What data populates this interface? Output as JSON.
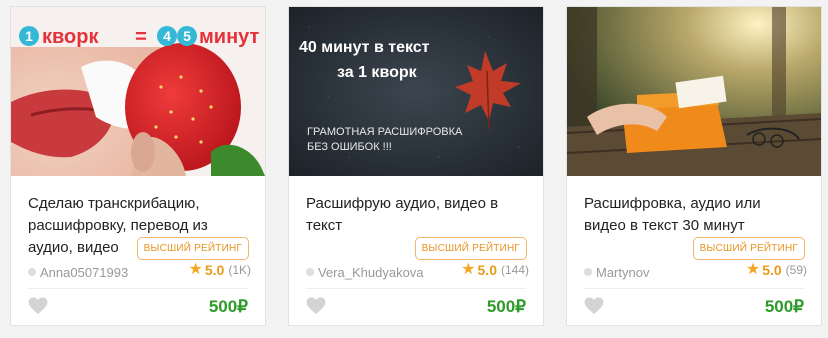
{
  "cards": [
    {
      "image": {
        "counter_left": "1",
        "word": "кворк",
        "equals": "=",
        "counter_right_a": "4",
        "counter_right_b": "5",
        "word_right": "минут"
      },
      "title": "Сделаю транскрибацию, расшифровку, перевод из аудио, видео",
      "badge": "Высший рейтинг",
      "seller": "Anna05071993",
      "rating": "5.0",
      "reviews": "(1K)",
      "price": "500₽"
    },
    {
      "image": {
        "line1": "40 минут в текст",
        "line2": "за 1 кворк",
        "line3": "ГРАМОТНАЯ РАСШИФРОВКА",
        "line4": "БЕЗ ОШИБОК !!!"
      },
      "title": "Расшифрую аудио, видео в текст",
      "badge": "Высший рейтинг",
      "seller": "Vera_Khudyakova",
      "rating": "5.0",
      "reviews": "(144)",
      "price": "500₽"
    },
    {
      "image": {},
      "title": "Расшифровка, аудио или видео в текст 30 минут",
      "badge": "Высший рейтинг",
      "seller": "Martynov",
      "rating": "5.0",
      "reviews": "(59)",
      "price": "500₽"
    }
  ],
  "colors": {
    "price_green": "#2e9a29",
    "badge_orange": "#e8931e",
    "star": "#f6a623",
    "accent_teal": "#35b8d6",
    "accent_red": "#e5333b"
  },
  "icons": {
    "favorite": "heart-icon",
    "rating": "star-icon",
    "online_status": "status-dot-icon"
  }
}
